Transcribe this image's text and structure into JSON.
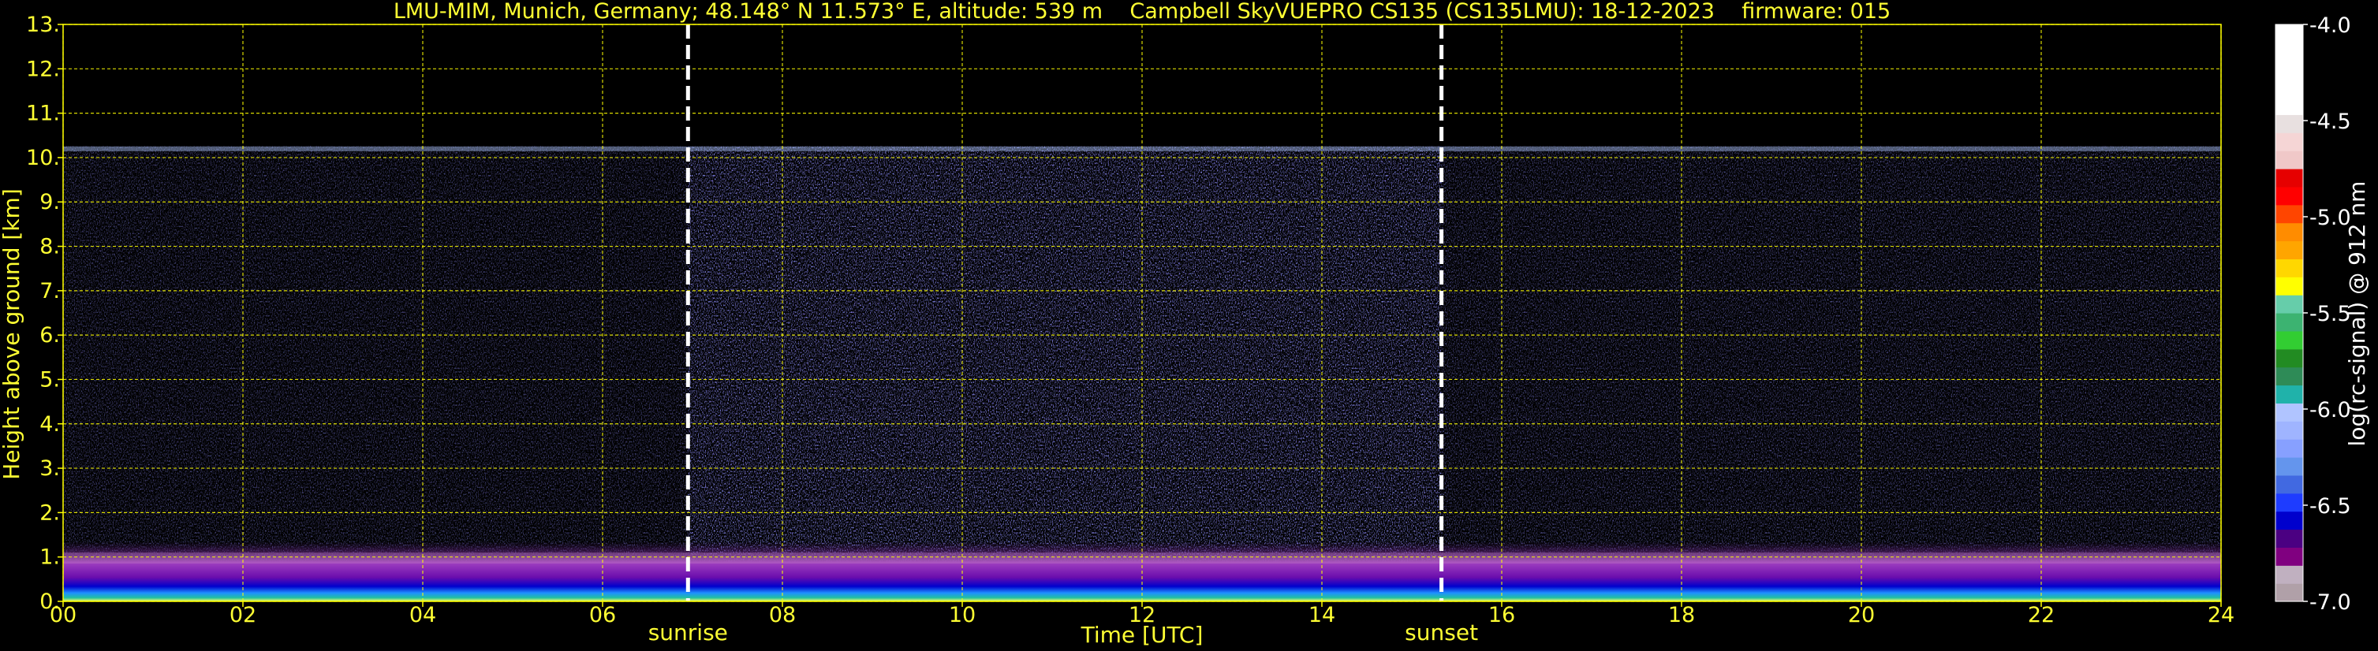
{
  "chart_data": {
    "type": "heatmap",
    "title": "LMU-MIM, Munich, Germany; 48.148° N 11.573° E, altitude: 539 m    Campbell SkyVUEPRO CS135 (CS135LMU): 18-12-2023    firmware: 015",
    "xlabel": "Time [UTC]",
    "ylabel": "Height above ground [km]",
    "xlim": [
      0,
      24
    ],
    "ylim": [
      0,
      13
    ],
    "x_ticks": [
      "00",
      "02",
      "04",
      "06",
      "08",
      "10",
      "12",
      "14",
      "16",
      "18",
      "20",
      "22",
      "24"
    ],
    "x_tick_values": [
      0,
      2,
      4,
      6,
      8,
      10,
      12,
      14,
      16,
      18,
      20,
      22,
      24
    ],
    "y_ticks": [
      "0.",
      "1.",
      "2.",
      "3.",
      "4.",
      "5.",
      "6.",
      "7.",
      "8.",
      "9.",
      "10.",
      "11.",
      "12.",
      "13."
    ],
    "y_tick_values": [
      0,
      1,
      2,
      3,
      4,
      5,
      6,
      7,
      8,
      9,
      10,
      11,
      12,
      13
    ],
    "grid": true,
    "grid_color": "#ffff00",
    "signal_top_km": 10.25,
    "events": [
      {
        "name": "sunrise",
        "x": 6.95
      },
      {
        "name": "sunset",
        "x": 15.33
      }
    ],
    "colorbar": {
      "label": "log(rc-signal) @ 912 nm",
      "range": [
        -7.0,
        -4.0
      ],
      "ticks": [
        "-4.0",
        "-4.5",
        "-5.0",
        "-5.5",
        "-6.0",
        "-6.5",
        "-7.0"
      ],
      "tick_values": [
        -4.0,
        -4.5,
        -5.0,
        -5.5,
        -6.0,
        -6.5,
        -7.0
      ],
      "colors": [
        "#b0a0a8",
        "#c0b0c0",
        "#800080",
        "#4b0082",
        "#0000cd",
        "#1e3cff",
        "#4169e1",
        "#6495ed",
        "#87a0ff",
        "#9fb4ff",
        "#b0c4ff",
        "#20b2aa",
        "#2e8b57",
        "#228b22",
        "#32cd32",
        "#3cb371",
        "#66cdaa",
        "#ffff00",
        "#ffd700",
        "#ffa500",
        "#ff8c00",
        "#ff4500",
        "#ff0000",
        "#e60000",
        "#f0c8c8",
        "#f5d5d5",
        "#e8e0e0",
        "#ffffff",
        "#ffffff",
        "#ffffff",
        "#ffffff",
        "#ffffff"
      ]
    }
  }
}
